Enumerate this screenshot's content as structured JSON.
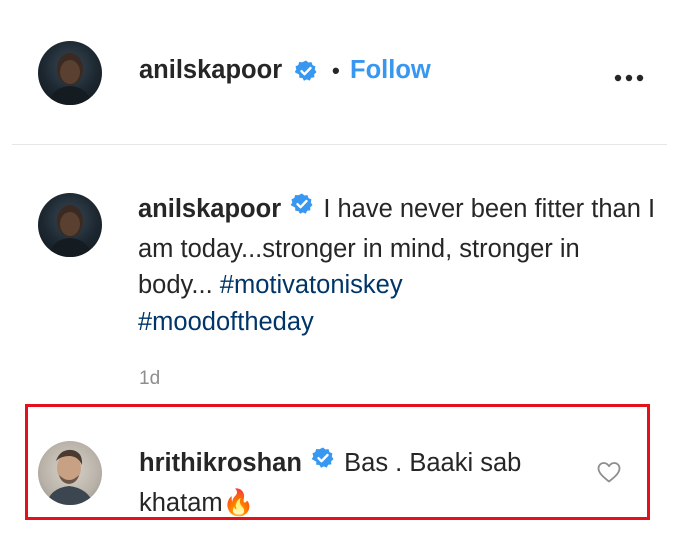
{
  "header": {
    "username": "anilskapoor",
    "separator": "•",
    "follow_label": "Follow",
    "more_icon": "more-horizontal-icon"
  },
  "caption": {
    "username": "anilskapoor",
    "text": "I have never been fitter than I am today...stronger in mind, stronger in body...",
    "hashtags": [
      "#motivatoniskey",
      "#moodoftheday"
    ],
    "time": "1d"
  },
  "comment": {
    "username": "hrithikroshan",
    "text": "Bas . Baaki sab khatam",
    "emoji": "🔥",
    "like_icon": "heart-icon"
  },
  "colors": {
    "link_blue": "#3897f0",
    "hashtag": "#003569",
    "highlight_border": "#e3101e",
    "verified_badge": "#3897f0",
    "muted": "#8e8e8e"
  }
}
